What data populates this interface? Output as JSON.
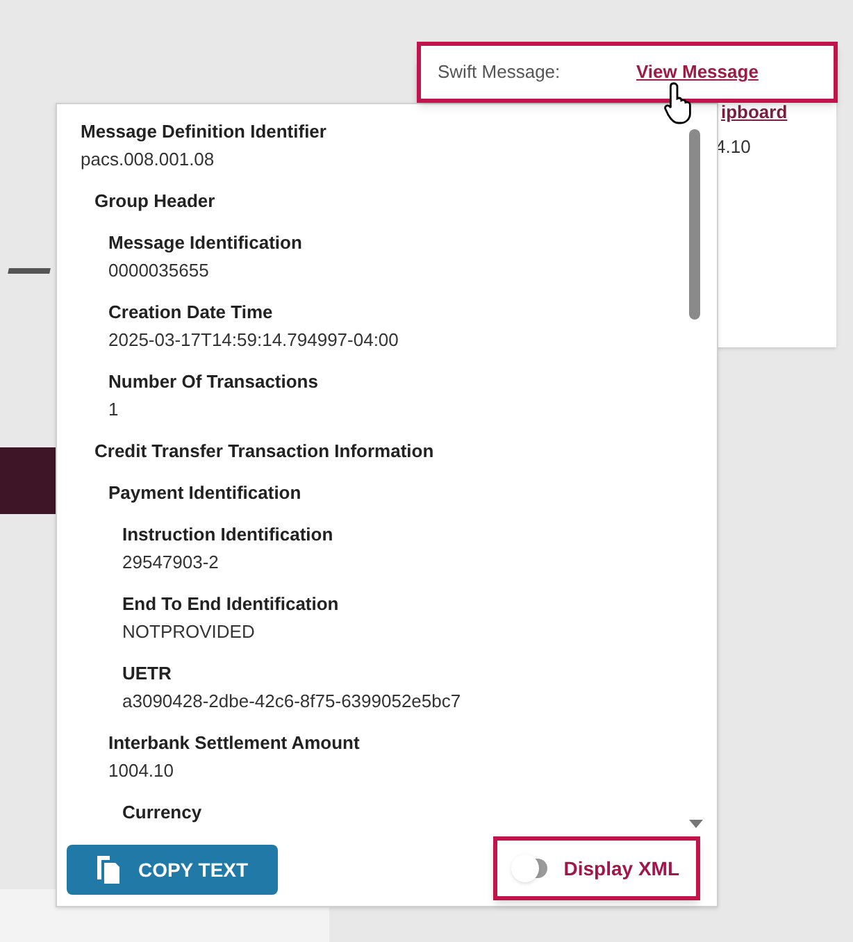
{
  "background_card": {
    "link_fragment": "ipboard",
    "value_fragment": "4.10"
  },
  "swift_message": {
    "label": "Swift Message:",
    "link": "View Message"
  },
  "message_tree": [
    {
      "label": "Message Definition Identifier",
      "value": "pacs.008.001.08",
      "children": [
        {
          "label": "Group Header",
          "children": [
            {
              "label": "Message Identification",
              "value": "0000035655"
            },
            {
              "label": "Creation Date Time",
              "value": "2025-03-17T14:59:14.794997-04:00"
            },
            {
              "label": "Number Of Transactions",
              "value": "1"
            }
          ]
        },
        {
          "label": "Credit Transfer Transaction Information",
          "children": [
            {
              "label": "Payment Identification",
              "children": [
                {
                  "label": "Instruction Identification",
                  "value": "29547903-2"
                },
                {
                  "label": "End To End Identification",
                  "value": "NOTPROVIDED"
                },
                {
                  "label": "UETR",
                  "value": "a3090428-2dbe-42c6-8f75-6399052e5bc7"
                }
              ]
            },
            {
              "label": "Interbank Settlement Amount",
              "value": "1004.10",
              "children": [
                {
                  "label": "Currency"
                }
              ]
            }
          ]
        }
      ]
    }
  ],
  "copy_button": {
    "label": "COPY TEXT"
  },
  "display_xml": {
    "label": "Display XML",
    "on": false
  }
}
